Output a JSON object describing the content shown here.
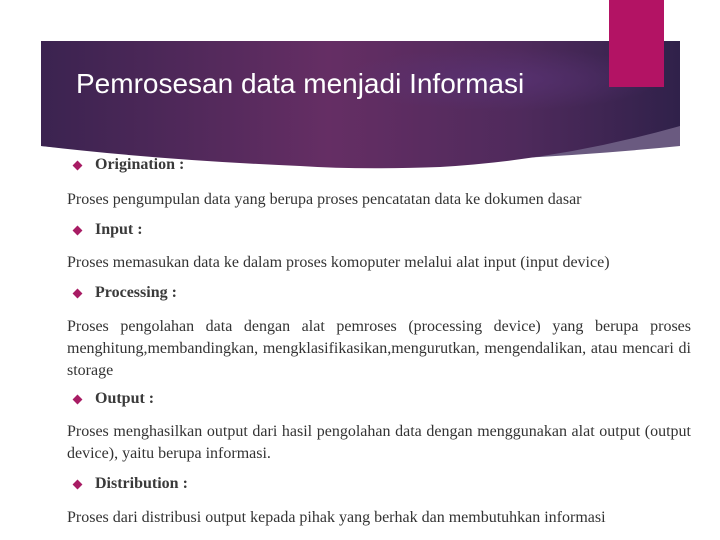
{
  "slide": {
    "title": "Pemrosesan data menjadi Informasi",
    "colors": {
      "banner_dark": "#3a2450",
      "banner_mid": "#632d63",
      "banner_band": "#6a5a80",
      "accent": "#b31364",
      "bullet": "#a81c64",
      "text": "#333333"
    },
    "items": [
      {
        "icon": "diamond-bullet-icon",
        "heading": "Origination :",
        "description": "Proses pengumpulan data yang berupa proses pencatatan data ke dokumen dasar"
      },
      {
        "icon": "diamond-bullet-icon",
        "heading": "Input :",
        "description": "Proses memasukan data ke dalam proses komoputer melalui alat input (input device)"
      },
      {
        "icon": "diamond-bullet-icon",
        "heading": "Processing :",
        "description": "Proses pengolahan data dengan alat pemroses (processing device) yang berupa proses menghitung,membandingkan, mengklasifikasikan,mengurutkan, mengendalikan, atau mencari di storage"
      },
      {
        "icon": "diamond-bullet-icon",
        "heading": "Output :",
        "description": "Proses menghasilkan output dari hasil pengolahan data dengan menggunakan alat output (output device), yaitu berupa informasi."
      },
      {
        "icon": "diamond-bullet-icon",
        "heading": "Distribution :",
        "description": "Proses dari distribusi output kepada pihak yang berhak dan membutuhkan informasi"
      }
    ]
  }
}
